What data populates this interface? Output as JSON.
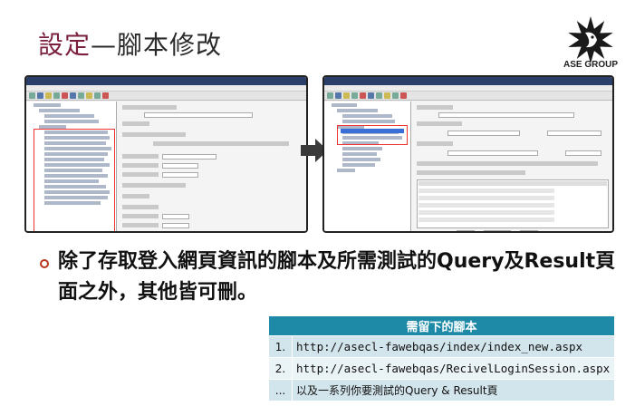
{
  "slide": {
    "title_accent": "設定",
    "title_rest": "—腳本修改",
    "logo_text": "ASE GROUP"
  },
  "bullet": {
    "text": "除了存取登入網頁資訊的腳本及所需測試的Query及Result頁面之外，其他皆可刪。"
  },
  "table": {
    "header": "需留下的腳本",
    "rows": [
      {
        "index": "1.",
        "value": "http://asecl-fawebqas/index/index_new.aspx"
      },
      {
        "index": "2.",
        "value": "http://asecl-fawebqas/RecivelLoginSession.aspx"
      },
      {
        "index": "...",
        "value": "以及一系列你要測試的Query & Result頁"
      }
    ]
  },
  "colors": {
    "title_accent": "#7a1f3d",
    "table_header": "#1f8aa8",
    "highlight": "#e33333"
  },
  "icons": [
    "logo-sun-icon",
    "arrow-right-icon",
    "bullet-circle-icon"
  ]
}
